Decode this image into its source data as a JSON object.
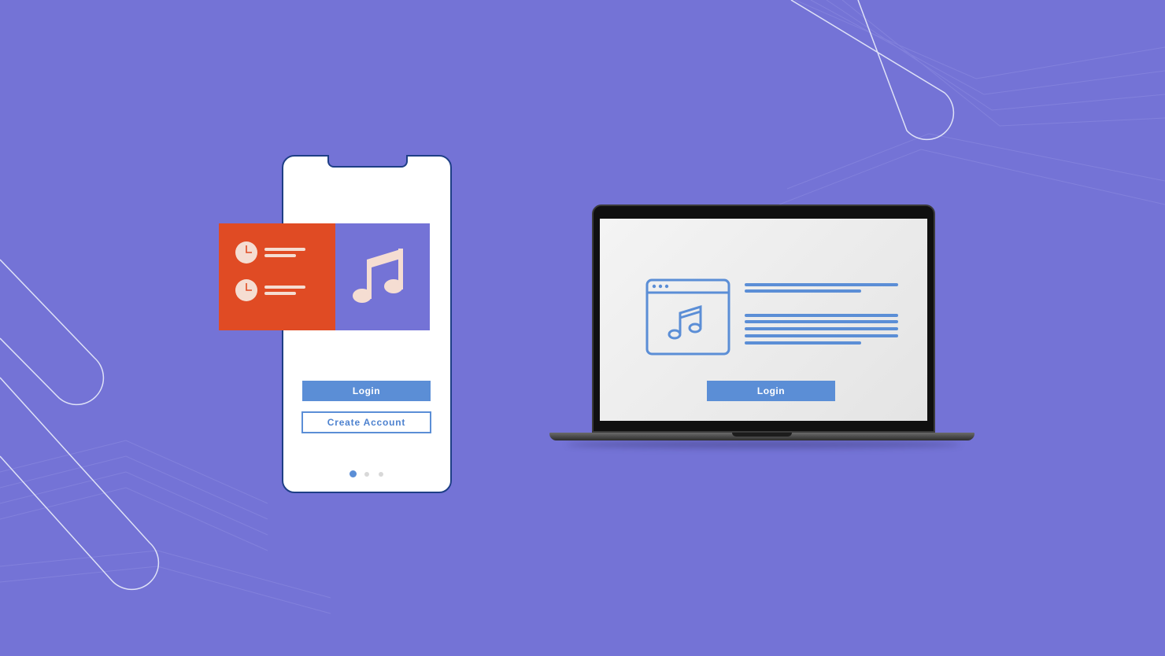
{
  "colors": {
    "background": "#7473d6",
    "accent_blue": "#5b8ed6",
    "accent_orange": "#e04b24",
    "phone_frame": "#1e3f86"
  },
  "phone": {
    "cards": {
      "list_icons": [
        "clock-icon",
        "clock-icon"
      ],
      "music_icon": "music-note-icon"
    },
    "login_label": "Login",
    "create_account_label": "Create Account",
    "carousel": {
      "pages": 3,
      "active_page": 1
    }
  },
  "laptop": {
    "app_icon": "browser-music-icon",
    "login_label": "Login"
  }
}
